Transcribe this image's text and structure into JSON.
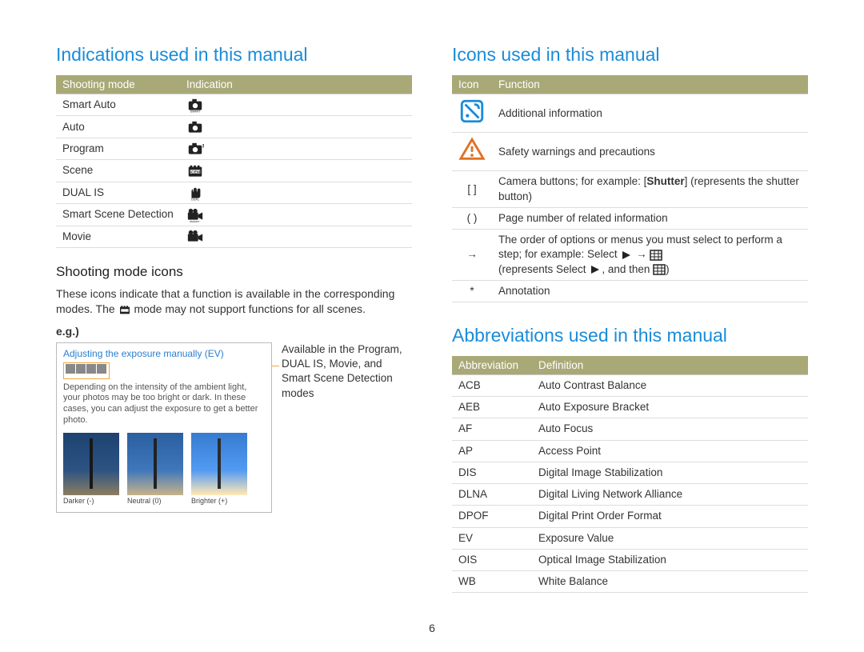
{
  "page_number": "6",
  "left": {
    "heading": "Indications used in this manual",
    "shooting_table": {
      "col1": "Shooting mode",
      "col2": "Indication",
      "rows": [
        {
          "mode": "Smart Auto",
          "icon": "camera-smart-icon"
        },
        {
          "mode": "Auto",
          "icon": "camera-icon"
        },
        {
          "mode": "Program",
          "icon": "camera-p-icon"
        },
        {
          "mode": "Scene",
          "icon": "scene-icon"
        },
        {
          "mode": "DUAL IS",
          "icon": "hand-dual-icon"
        },
        {
          "mode": "Smart Scene Detection",
          "icon": "movie-smart-icon"
        },
        {
          "mode": "Movie",
          "icon": "movie-icon"
        }
      ]
    },
    "sub_heading": "Shooting mode icons",
    "para_before": "These icons indicate that a function is available in the corresponding modes. The ",
    "para_after": " mode may not support functions for all scenes.",
    "eg_label": "e.g.)",
    "callout": {
      "title": "Adjusting the exposure manually (EV)",
      "body": "Depending on the intensity of the ambient light, your photos may be too bright or dark. In these cases, you can adjust the exposure to get a better photo.",
      "thumbs": [
        "Darker (-)",
        "Neutral (0)",
        "Brighter (+)"
      ]
    },
    "callout_side": "Available in the Program, DUAL IS, Movie, and Smart Scene Detection modes"
  },
  "right": {
    "icons_heading": "Icons used in this manual",
    "icons_table": {
      "col1": "Icon",
      "col2": "Function",
      "rows": [
        {
          "icon": "note-icon",
          "text_parts": [
            "Additional information"
          ]
        },
        {
          "icon": "warning-icon",
          "text_parts": [
            "Safety warnings and precautions"
          ]
        },
        {
          "icon": "brackets-icon",
          "text_parts": [
            "Camera buttons; for example: [",
            "Shutter",
            "] (represents the shutter button)"
          ]
        },
        {
          "icon": "paren-icon",
          "text_parts": [
            "Page number of related information"
          ]
        },
        {
          "icon": "arrow-icon",
          "text_parts": [
            "The order of options or menus you must select to perform a step; for example: Select ",
            " → ",
            " (represents Select ",
            ", and then ",
            ")"
          ]
        },
        {
          "icon": "asterisk-icon",
          "text_parts": [
            "Annotation"
          ]
        }
      ],
      "icon_labels": {
        "brackets": "[  ]",
        "paren": "(  )",
        "arrow": "→",
        "asterisk": "*"
      }
    },
    "abbr_heading": "Abbreviations used in this manual",
    "abbr_table": {
      "col1": "Abbreviation",
      "col2": "Definition",
      "rows": [
        {
          "abbr": "ACB",
          "def": "Auto Contrast Balance"
        },
        {
          "abbr": "AEB",
          "def": "Auto Exposure Bracket"
        },
        {
          "abbr": "AF",
          "def": "Auto Focus"
        },
        {
          "abbr": "AP",
          "def": "Access Point"
        },
        {
          "abbr": "DIS",
          "def": "Digital Image Stabilization"
        },
        {
          "abbr": "DLNA",
          "def": "Digital Living Network Alliance"
        },
        {
          "abbr": "DPOF",
          "def": "Digital Print Order Format"
        },
        {
          "abbr": "EV",
          "def": "Exposure Value"
        },
        {
          "abbr": "OIS",
          "def": "Optical Image Stabilization"
        },
        {
          "abbr": "WB",
          "def": "White Balance"
        }
      ]
    }
  }
}
